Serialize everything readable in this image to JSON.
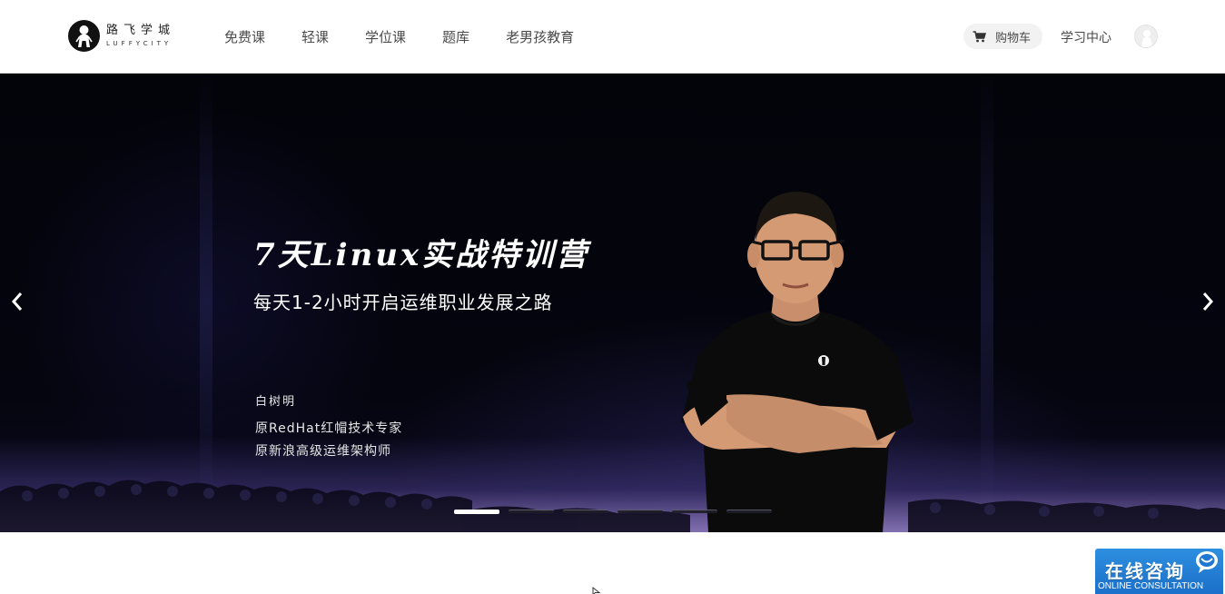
{
  "header": {
    "logo": {
      "cn": "路飞学城",
      "en": "LUFFYCITY"
    },
    "nav": [
      {
        "label": "免费课"
      },
      {
        "label": "轻课"
      },
      {
        "label": "学位课"
      },
      {
        "label": "题库"
      },
      {
        "label": "老男孩教育"
      }
    ],
    "cart_label": "购物车",
    "study_center_label": "学习中心"
  },
  "banner": {
    "title": "7天Linux实战特训营",
    "subtitle": "每天1-2小时开启运维职业发展之路",
    "instructor_name": "白树明",
    "role_line1": "原RedHat红帽技术专家",
    "role_line2": "原新浪高级运维架构师",
    "slide_count": 6,
    "active_slide": 1
  },
  "chat_widget": {
    "title": "在线咨询",
    "subtitle": "ONLINE CONSULTATION"
  },
  "colors": {
    "chat_blue": "#1f78d1",
    "nav_text": "#4a4a4a"
  },
  "icons": [
    "logo-icon",
    "cart-icon",
    "avatar-icon",
    "chevron-left-icon",
    "chevron-right-icon",
    "chat-bubble-icon",
    "mouse-cursor-icon"
  ]
}
